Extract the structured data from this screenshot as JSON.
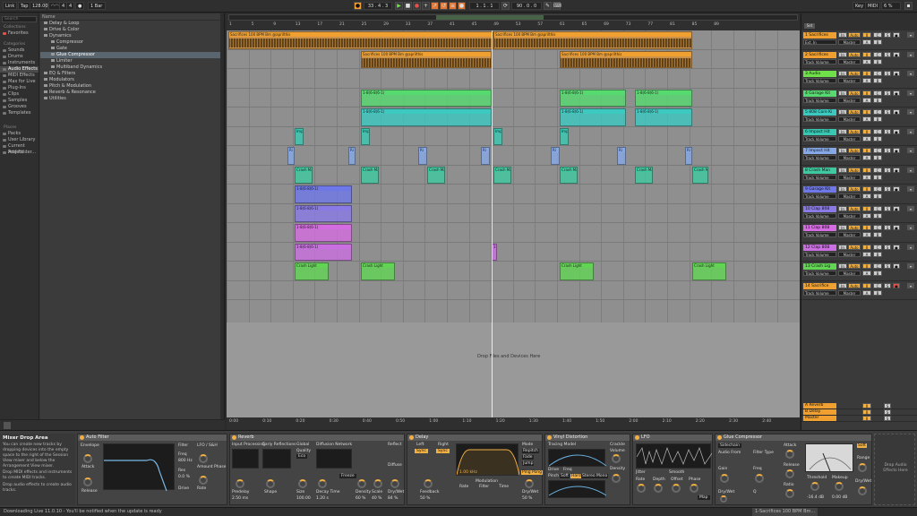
{
  "topbar": {
    "link": "Link",
    "tap": "Tap",
    "tempo": "128.00",
    "sig_num": "4",
    "sig_den": "4",
    "quant": "1 Bar",
    "position": "33 .  4 .  3",
    "loop_start": "1 .  1 .  1",
    "loop_len": "90 .  0 .  0",
    "key": "Key",
    "midi": "MIDI",
    "cpu": "6 %"
  },
  "browser": {
    "search_placeholder": "Search",
    "collections_header": "Collections",
    "favorites": "Favorites",
    "categories_header": "Categories",
    "categories": [
      "Sounds",
      "Drums",
      "Instruments",
      "Audio Effects",
      "MIDI Effects",
      "Max for Live",
      "Plug-Ins",
      "Clips",
      "Samples",
      "Grooves",
      "Templates"
    ],
    "selected_category": "Audio Effects",
    "places_header": "Places",
    "places": [
      "Packs",
      "User Library",
      "Current Project",
      "Add Folder..."
    ],
    "name_header": "Name",
    "tree": [
      {
        "label": "Delay & Loop",
        "depth": 0
      },
      {
        "label": "Drive & Color",
        "depth": 0
      },
      {
        "label": "Dynamics",
        "depth": 0
      },
      {
        "label": "Compressor",
        "depth": 1
      },
      {
        "label": "Gate",
        "depth": 1
      },
      {
        "label": "Glue Compressor",
        "depth": 1,
        "selected": true
      },
      {
        "label": "Limiter",
        "depth": 1
      },
      {
        "label": "Multiband Dynamics",
        "depth": 1
      },
      {
        "label": "EQ & Filters",
        "depth": 0
      },
      {
        "label": "Modulators",
        "depth": 0
      },
      {
        "label": "Pitch & Modulation",
        "depth": 0
      },
      {
        "label": "Reverb & Resonance",
        "depth": 0
      },
      {
        "label": "Utilities",
        "depth": 0
      }
    ]
  },
  "arrangement": {
    "bar_numbers": [
      "1",
      "5",
      "9",
      "13",
      "17",
      "21",
      "25",
      "29",
      "33",
      "37",
      "41",
      "45",
      "49",
      "53",
      "57",
      "61",
      "65",
      "69",
      "73",
      "77",
      "81",
      "85",
      "89"
    ],
    "time_labels": [
      "0:00",
      "0:10",
      "0:20",
      "0:30",
      "0:40",
      "0:50",
      "1:00",
      "1:10",
      "1:20",
      "1:30",
      "1:40",
      "1:50",
      "2:00",
      "2:10",
      "2:20",
      "2:30",
      "2:40"
    ],
    "drop_hint": "Drop Files and Devices Here",
    "sacrifices_clip_name": "Sacrifices 100 BPM Bm @aprilthis",
    "crash_clip_name": "Crash Ma",
    "crash_light_clip_name": "Crash Light",
    "imp_clip_name": "Imp",
    "ri_clip_name": "Ri",
    "pattern_clip_name": "1-8(6-8(6-1)"
  },
  "tracks": [
    {
      "name": "1 Sacrifices",
      "color": "#f0a030",
      "input": "Ext. In",
      "out": "Master",
      "vol": "0",
      "pan": "C"
    },
    {
      "name": "2 Sacrifices",
      "color": "#f0a030",
      "input": "Track Volume",
      "out": "Master",
      "vol": "0",
      "pan": "C"
    },
    {
      "name": "3 Audio",
      "color": "#6fe04a",
      "input": "Track Volume",
      "out": "Master",
      "vol": "0",
      "pan": "C"
    },
    {
      "name": "4 Garage Kit",
      "color": "#56d96f",
      "input": "Track Volume",
      "out": "Master",
      "vol": "0",
      "pan": "C"
    },
    {
      "name": "5 808 Core Ki",
      "color": "#3cc9c0",
      "input": "Track Volume",
      "out": "Master",
      "vol": "0",
      "pan": "C"
    },
    {
      "name": "6 Impact Hit",
      "color": "#38c8b2",
      "input": "Track Volume",
      "out": "Master",
      "vol": "0",
      "pan": "C"
    },
    {
      "name": "7 Impact Hit",
      "color": "#86a8e6",
      "input": "Track Volume",
      "out": "Master",
      "vol": "0",
      "pan": "C"
    },
    {
      "name": "8 Crash Man",
      "color": "#3fc9a0",
      "input": "Track Volume",
      "out": "Master",
      "vol": "0",
      "pan": "C"
    },
    {
      "name": "9 Garage Kit",
      "color": "#6f78e8",
      "input": "Track Volume",
      "out": "Master",
      "vol": "0",
      "pan": "C"
    },
    {
      "name": "10 Clap 808",
      "color": "#8a7ae6",
      "input": "Track Volume",
      "out": "Master",
      "vol": "0",
      "pan": "C"
    },
    {
      "name": "11 Clap 808",
      "color": "#d46be0",
      "input": "Track Volume",
      "out": "Master",
      "vol": "0",
      "pan": "C"
    },
    {
      "name": "12 Clap 808",
      "color": "#c96fe0",
      "input": "Track Volume",
      "out": "Master",
      "vol": "0",
      "pan": "C"
    },
    {
      "name": "13 Crash Lig",
      "color": "#62d454",
      "input": "Track Volume",
      "out": "Master",
      "vol": "0",
      "pan": "C"
    },
    {
      "name": "14 Sacrifice",
      "color": "#f0a030",
      "input": "Track Volume",
      "out": "Master",
      "vol": "0",
      "pan": "C"
    }
  ],
  "returns": [
    {
      "name": "A Reverb",
      "color": "#f0a030"
    },
    {
      "name": "B Delay",
      "color": "#f0a030"
    },
    {
      "name": "Master",
      "color": "#f0a030"
    }
  ],
  "info": {
    "title": "Mixer Drop Area",
    "body": "You can create new tracks by dropping devices into the empty space to the right of the Session View mixer and below the Arrangement View mixer.",
    "bullet1": "Drop MIDI effects and instruments to create MIDI tracks.",
    "bullet2": "Drop audio effects to create audio tracks."
  },
  "devices": {
    "auto_filter": {
      "name": "Auto Filter",
      "envelope": "Envelope",
      "attack": "Attack",
      "release": "Release",
      "freq": "Freq",
      "res": "Res",
      "lfo": "LFO / S&H",
      "amount": "Amount",
      "rate": "Rate",
      "phase": "Phase",
      "filter": "Filter",
      "freq_val": "800 Hz",
      "res_val": "0.0 %",
      "drive": "Drive"
    },
    "reverb": {
      "name": "Reverb",
      "input": "Input Processing",
      "early": "Early Reflections",
      "global": "Global",
      "diffusion": "Diffusion Network",
      "reflect": "Reflect",
      "diffuse": "Diffuse",
      "predelay": "Predelay",
      "shape": "Shape",
      "size": "Size",
      "decay": "Decay Time",
      "density": "Density",
      "scale": "Scale",
      "drywet": "Dry/Wet",
      "freeze": "Freeze",
      "flat": "Flat",
      "cut": "Cut",
      "chorus": "Chorus",
      "quality": "Quality",
      "eco": "Eco",
      "hi_shelf": "Hi Shelf",
      "predelay_val": "2.50 ms",
      "size_val": "100.00",
      "decay_val": "1.20 s",
      "density_val": "60 %",
      "scale_val": "40 %",
      "drywet_val": "84 %"
    },
    "delay": {
      "name": "Delay",
      "left": "Left",
      "right": "Right",
      "sync": "Sync",
      "time": "Time",
      "feedback": "Feedback",
      "filter": "Filter",
      "freq": "1.00 kHz",
      "width": "Width",
      "mode": "Mode",
      "repitch": "Repitch",
      "fade": "Fade",
      "jump": "Jump",
      "ping_pong": "Ping Pong",
      "drywet": "Dry/Wet",
      "rate": "Rate",
      "filter_mod": "Filter",
      "time_mod": "Time",
      "modulation": "Modulation",
      "feedback_val": "50 %",
      "drywet_val": "50 %"
    },
    "vinyl": {
      "name": "Vinyl Distortion",
      "tracing": "Tracing Model",
      "crackle": "Crackle",
      "volume": "Volume",
      "density": "Density",
      "pinch": "Pinch",
      "drive": "Drive",
      "freq": "Freq",
      "width": "Width",
      "soft": "Soft",
      "hard": "Hard",
      "stereo": "Stereo",
      "mono": "Mono"
    },
    "lfo": {
      "name": "LFO",
      "rate": "Rate",
      "depth": "Depth",
      "offset": "Offset",
      "phase": "Phase",
      "jitter": "Jitter",
      "smooth": "Smooth",
      "map": "Map"
    },
    "glue": {
      "name": "Glue Compressor",
      "sidechain": "Sidechain",
      "audio_from": "Audio From",
      "filter_type": "Filter Type",
      "gain": "Gain",
      "drywet": "Dry/Wet",
      "freq": "Freq",
      "q": "Q",
      "attack": "Attack",
      "release": "Release",
      "ratio": "Ratio",
      "threshold": "Threshold",
      "makeup": "Makeup",
      "soft_clip": "Soft",
      "range": "Range",
      "threshold_val": "-16.4 dB",
      "makeup_val": "0.00 dB",
      "ratio_val": "4"
    },
    "drop_hint": "Drop Audio Effects Here"
  },
  "status": {
    "message": "Downloading Live 11.0.10 - You'll be notified when the update is ready",
    "right": "1-Sacrifices 100 BPM Bm..."
  }
}
